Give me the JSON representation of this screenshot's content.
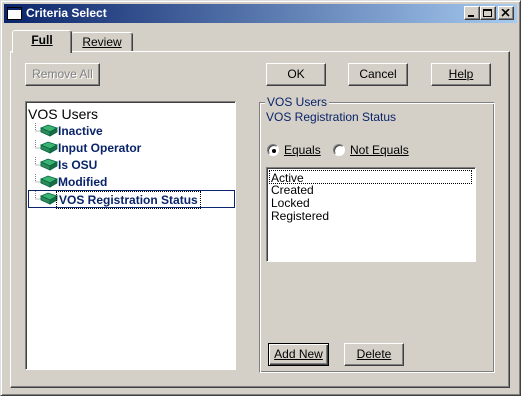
{
  "window": {
    "title": "Criteria Select",
    "icon": "window-app-icon",
    "caption_buttons": [
      "minimize-icon",
      "maximize-icon",
      "close-icon"
    ]
  },
  "tabs": [
    {
      "label": "Full",
      "active": true
    },
    {
      "label": "Review",
      "underline": "Review",
      "active": false
    }
  ],
  "toolbar": {
    "remove_all": "Remove All",
    "ok": "OK",
    "cancel": "Cancel",
    "help": "Help"
  },
  "tree": {
    "root": "VOS Users",
    "icon": "book-icon",
    "items": [
      {
        "label": "Inactive"
      },
      {
        "label": "Input Operator"
      },
      {
        "label": "Is OSU"
      },
      {
        "label": "Modified"
      },
      {
        "label": "VOS Registration Status",
        "selected": true
      }
    ]
  },
  "criteria": {
    "group_title": "VOS Users",
    "field": "VOS Registration Status",
    "operators": [
      {
        "label": "Equals",
        "checked": true
      },
      {
        "label": "Not Equals",
        "checked": false
      }
    ],
    "values": [
      "Active",
      "Created",
      "Locked",
      "Registered"
    ],
    "add_new": "Add New",
    "delete": "Delete"
  },
  "colors": {
    "face": "#d4d0c8",
    "title_start": "#0a246a",
    "title_end": "#a6caf0",
    "accent_text": "#0a246a",
    "book_green": "#2e8b57"
  }
}
